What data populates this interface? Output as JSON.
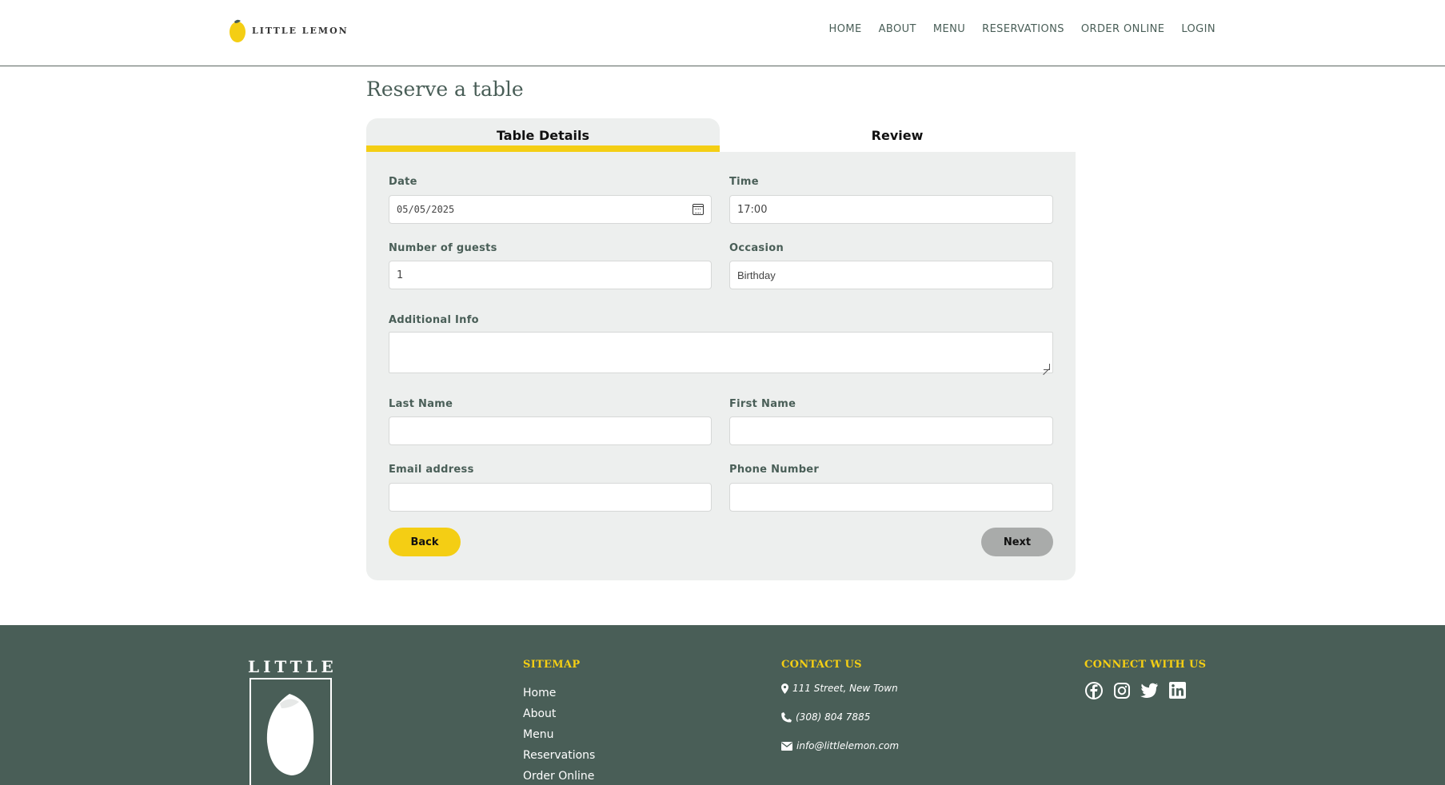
{
  "brand": {
    "name": "LITTLE LEMON",
    "accent": "#f4ce14",
    "primary": "#495e57"
  },
  "nav": {
    "items": [
      {
        "label": "HOME"
      },
      {
        "label": "ABOUT"
      },
      {
        "label": "MENU"
      },
      {
        "label": "RESERVATIONS"
      },
      {
        "label": "ORDER ONLINE"
      },
      {
        "label": "LOGIN"
      }
    ]
  },
  "page": {
    "title": "Reserve a table"
  },
  "tabs": {
    "details": "Table Details",
    "review": "Review"
  },
  "form": {
    "date": {
      "label": "Date",
      "value": "05/05/2025",
      "icon": "calendar-icon"
    },
    "time": {
      "label": "Time",
      "value": "17:00"
    },
    "guests": {
      "label": "Number of guests",
      "value": "1"
    },
    "occasion": {
      "label": "Occasion",
      "value": "Birthday"
    },
    "additional": {
      "label": "Additional Info",
      "value": ""
    },
    "last_name": {
      "label": "Last Name",
      "value": ""
    },
    "first_name": {
      "label": "First Name",
      "value": ""
    },
    "email": {
      "label": "Email address",
      "value": ""
    },
    "phone": {
      "label": "Phone Number",
      "value": ""
    },
    "back_label": "Back",
    "next_label": "Next"
  },
  "footer": {
    "logo_text": "LITTLE",
    "sitemap": {
      "heading": "SITEMAP",
      "items": [
        "Home",
        "About",
        "Menu",
        "Reservations",
        "Order Online"
      ]
    },
    "contact": {
      "heading": "CONTACT US",
      "address": "111 Street, New Town",
      "phone": "(308) 804 7885",
      "email": "info@littlelemon.com"
    },
    "connect": {
      "heading": "CONNECT WITH US",
      "icons": [
        "facebook-icon",
        "instagram-icon",
        "twitter-icon",
        "linkedin-icon"
      ]
    }
  }
}
